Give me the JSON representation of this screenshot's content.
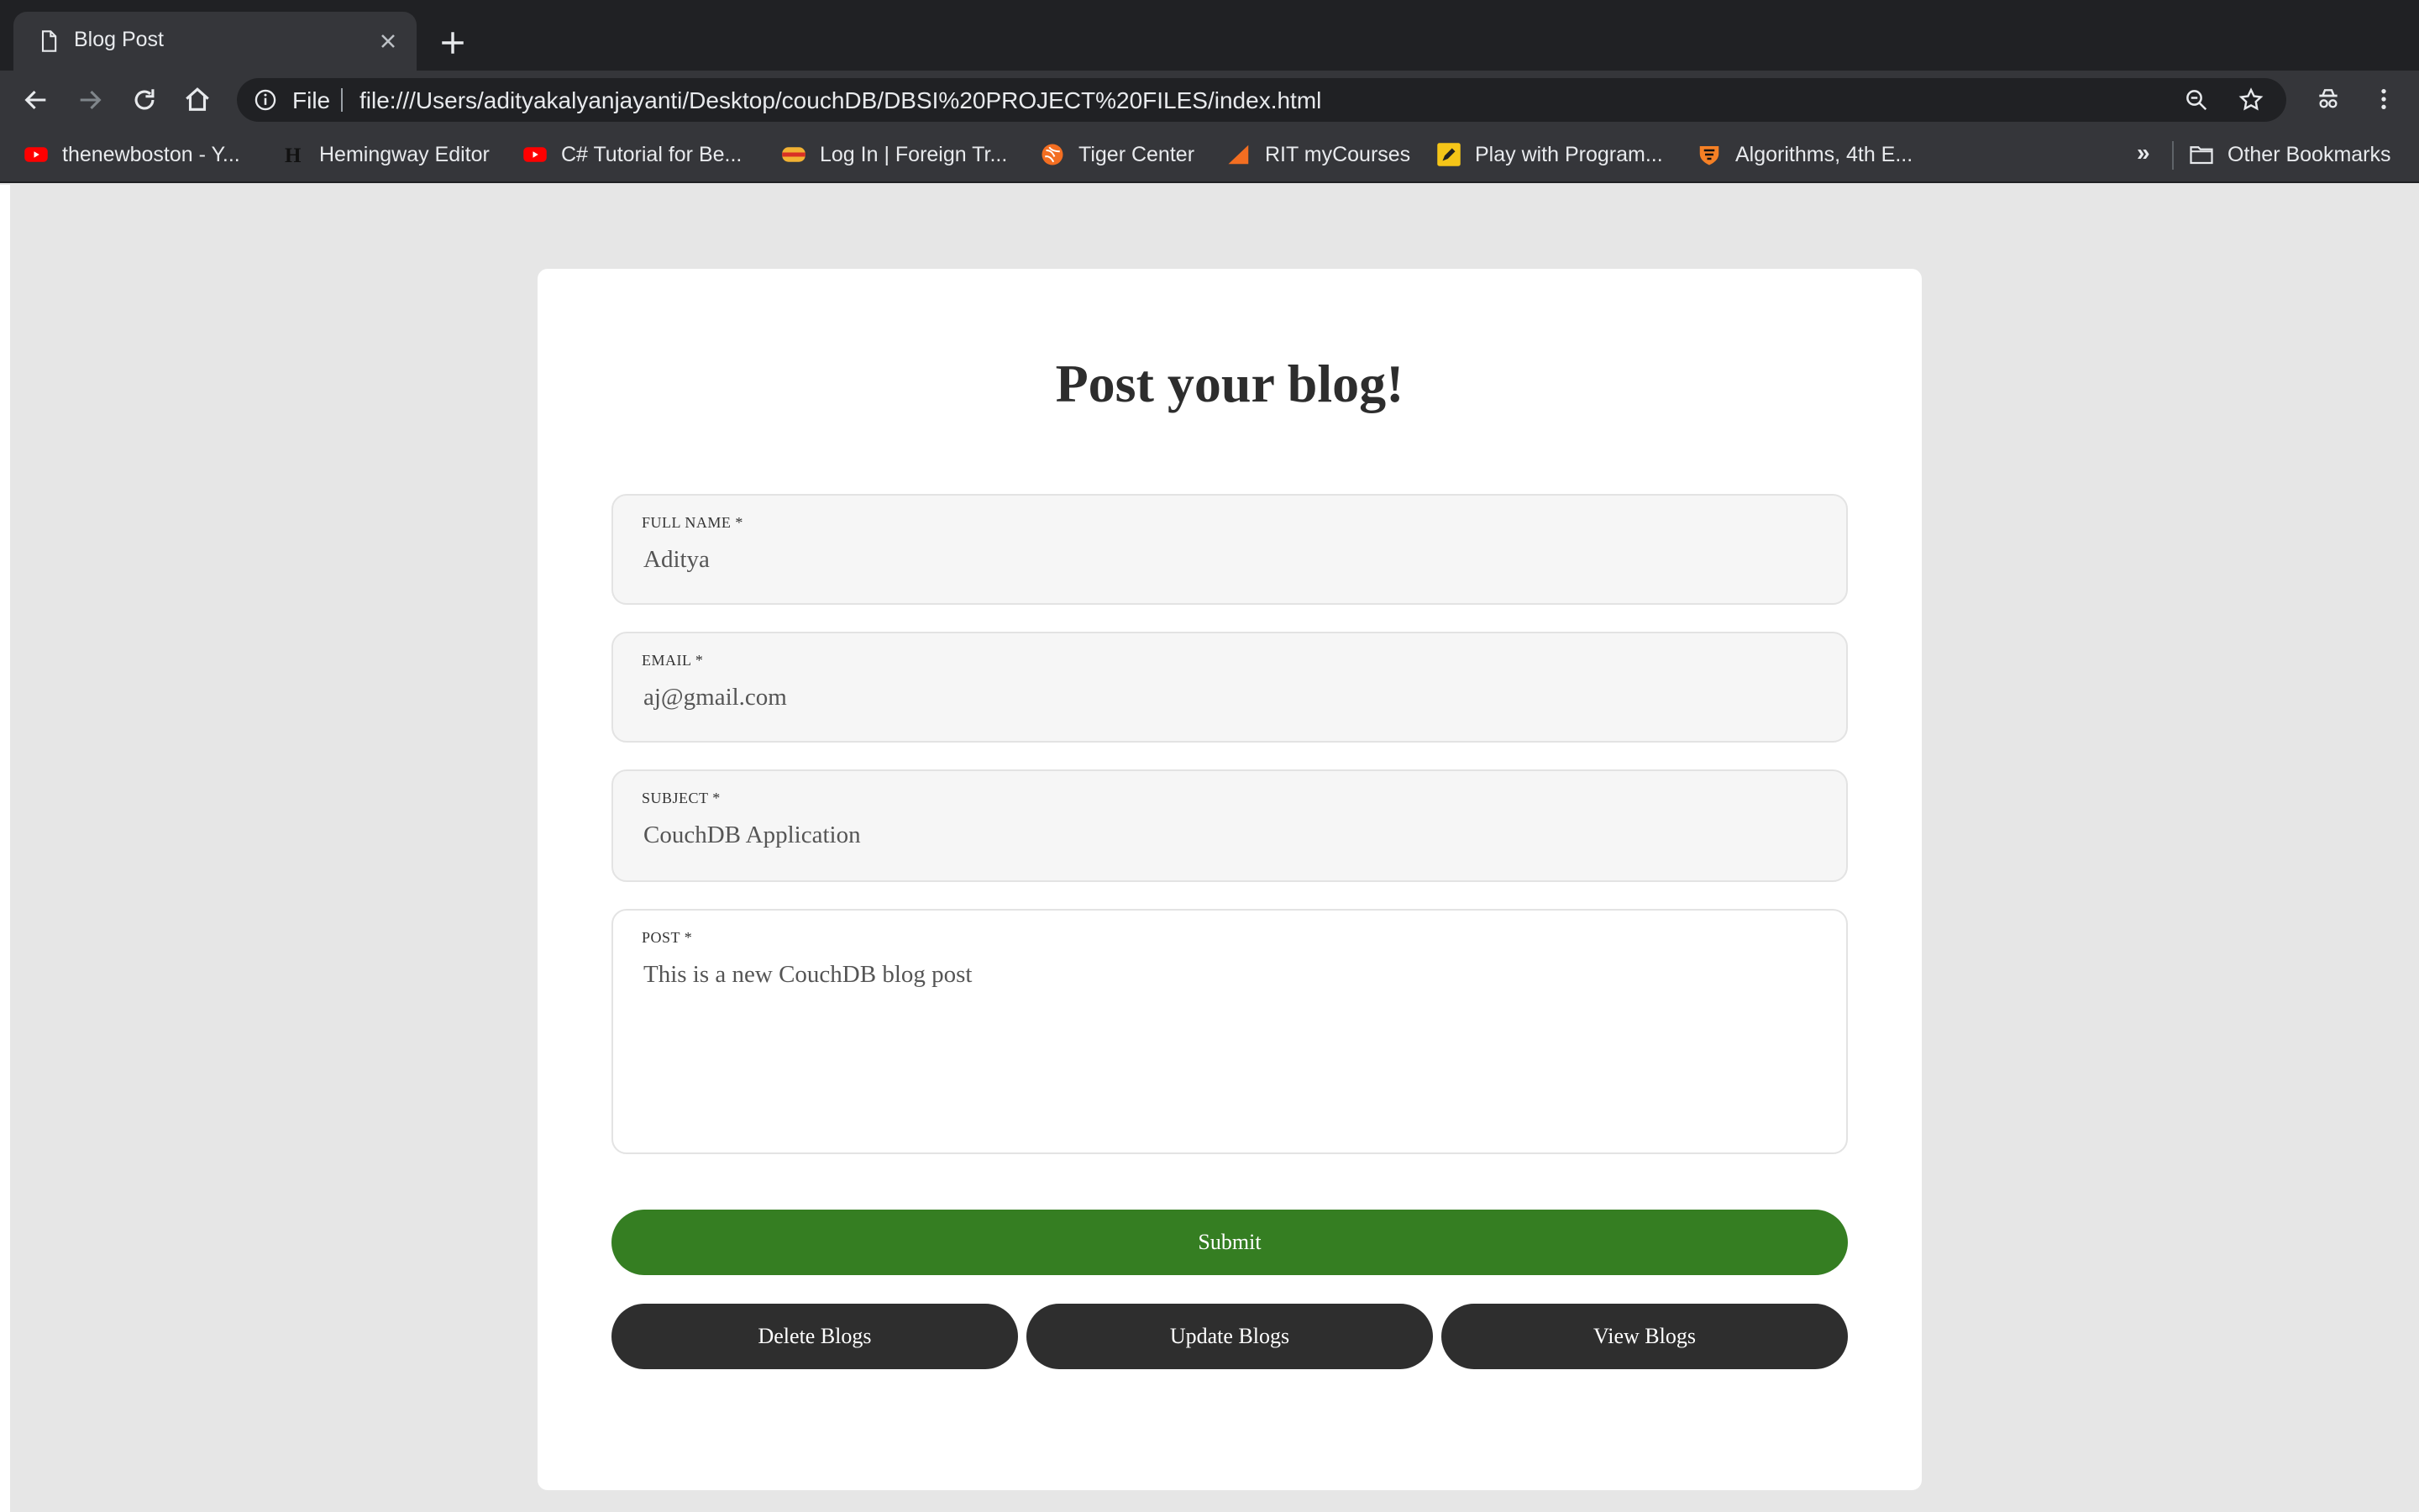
{
  "browser": {
    "tab": {
      "title": "Blog Post"
    },
    "omnibox": {
      "scheme": "File",
      "url": "file:///Users/adityakalyanjayanti/Desktop/couchDB/DBSI%20PROJECT%20FILES/index.html"
    },
    "bookmarks": [
      {
        "label": "thenewboston - Y...",
        "icon": "youtube-icon",
        "color": "#ff0000"
      },
      {
        "label": "Hemingway Editor",
        "icon": "hemingway-icon",
        "color": "#000000"
      },
      {
        "label": "C# Tutorial for Be...",
        "icon": "youtube-icon",
        "color": "#ff0000"
      },
      {
        "label": "Log In | Foreign Tr...",
        "icon": "card-icon",
        "color": "#d93025"
      },
      {
        "label": "Tiger Center",
        "icon": "tiger-icon",
        "color": "#f36e21"
      },
      {
        "label": "RIT myCourses",
        "icon": "triangle-icon",
        "color": "#f36e21"
      },
      {
        "label": "Play with Program...",
        "icon": "pencil-icon",
        "color": "#f5c518"
      },
      {
        "label": "Algorithms, 4th E...",
        "icon": "princeton-icon",
        "color": "#f58025"
      }
    ],
    "bookmarks_more": "»",
    "other_bookmarks": "Other Bookmarks"
  },
  "page": {
    "title": "Post your blog!",
    "form": {
      "full_name": {
        "label": "FULL NAME *",
        "value": "Aditya"
      },
      "email": {
        "label": "EMAIL *",
        "value": "aj@gmail.com"
      },
      "subject": {
        "label": "SUBJECT *",
        "value": "CouchDB Application"
      },
      "post": {
        "label": "POST *",
        "value": "This is a new CouchDB blog post"
      }
    },
    "buttons": {
      "submit": "Submit",
      "delete": "Delete Blogs",
      "update": "Update Blogs",
      "view": "View Blogs"
    }
  },
  "colors": {
    "submit": "#357e22",
    "dark_button": "#2e2e2e",
    "chrome_bg": "#35363a",
    "page_bg": "#e6e6e6"
  }
}
